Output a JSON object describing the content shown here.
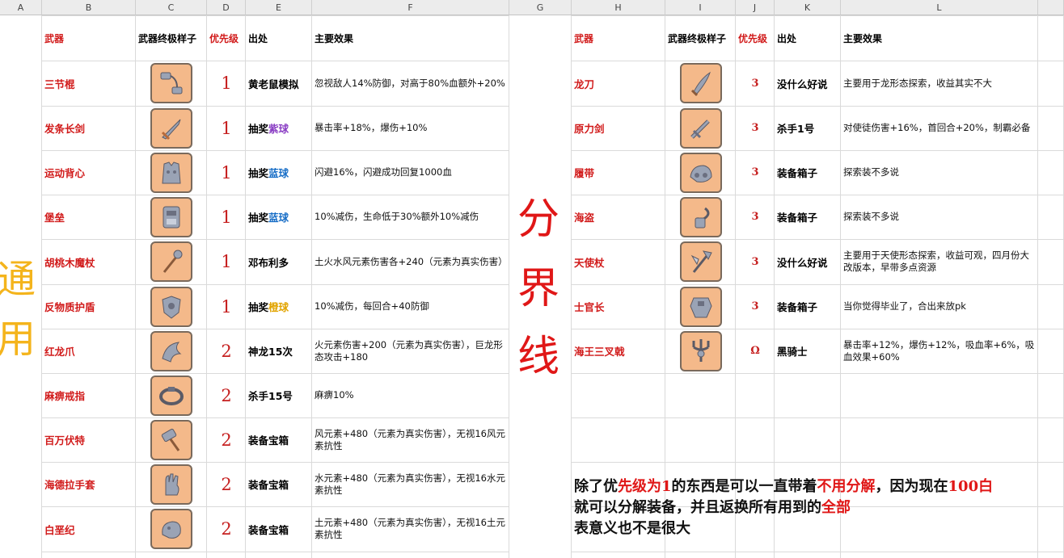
{
  "columns": [
    "A",
    "B",
    "C",
    "D",
    "E",
    "F",
    "G",
    "H",
    "I",
    "J",
    "K",
    "L"
  ],
  "left_headers": {
    "weapon": "武器",
    "look": "武器终极样子",
    "priority": "优先级",
    "source": "出处",
    "effect": "主要效果"
  },
  "right_headers": {
    "weapon": "武器",
    "look": "武器终极样子",
    "priority": "优先级",
    "source": "出处",
    "effect": "主要效果"
  },
  "left_rows": [
    {
      "name": "三节棍",
      "priority": "1",
      "source": "黄老鼠模拟",
      "source_suffix": "",
      "effect": "忽视敌人14%防御，对高于80%血额外+20%",
      "icon": "nunchaku-icon"
    },
    {
      "name": "发条长剑",
      "priority": "1",
      "source": "抽奖",
      "source_suffix": "紫球",
      "suffix_color": "purple",
      "effect": "暴击率+18%，爆伤+10%",
      "icon": "sword-icon"
    },
    {
      "name": "运动背心",
      "priority": "1",
      "source": "抽奖",
      "source_suffix": "蓝球",
      "suffix_color": "blue",
      "effect": "闪避16%，闪避成功回复1000血",
      "icon": "vest-icon"
    },
    {
      "name": "堡垒",
      "priority": "1",
      "source": "抽奖",
      "source_suffix": "蓝球",
      "suffix_color": "blue",
      "effect": "10%减伤，生命低于30%额外10%减伤",
      "icon": "fortress-icon"
    },
    {
      "name": "胡桃木魔杖",
      "priority": "1",
      "source": "邓布利多",
      "source_suffix": "",
      "effect": "土火水风元素伤害各+240（元素为真实伤害）",
      "icon": "wand-icon"
    },
    {
      "name": "反物质护盾",
      "priority": "1",
      "source": "抽奖",
      "source_suffix": "橙球",
      "suffix_color": "orange",
      "effect": "10%减伤，每回合+40防御",
      "icon": "shield-icon"
    },
    {
      "name": "红龙爪",
      "priority": "2",
      "source": "神龙15次",
      "source_suffix": "",
      "effect": "火元素伤害+200（元素为真实伤害），巨龙形态攻击+180",
      "icon": "claw-icon"
    },
    {
      "name": "麻痹戒指",
      "priority": "2",
      "source": "杀手15号",
      "source_suffix": "",
      "effect": "麻痹10%",
      "icon": "ring-icon"
    },
    {
      "name": "百万伏特",
      "priority": "2",
      "source": "装备宝箱",
      "source_suffix": "",
      "effect": "风元素+480（元素为真实伤害），无视16风元素抗性",
      "icon": "hammer-icon"
    },
    {
      "name": "海德拉手套",
      "priority": "2",
      "source": "装备宝箱",
      "source_suffix": "",
      "effect": "水元素+480（元素为真实伤害），无视16水元素抗性",
      "icon": "glove-icon"
    },
    {
      "name": "白垩纪",
      "priority": "2",
      "source": "装备宝箱",
      "source_suffix": "",
      "effect": "土元素+480（元素为真实伤害），无视16土元素抗性",
      "icon": "fossil-icon"
    }
  ],
  "right_rows": [
    {
      "name": "龙刀",
      "priority": "3",
      "source": "没什么好说",
      "effect": "主要用于龙形态探索，收益其实不大",
      "icon": "dagger-icon"
    },
    {
      "name": "原力剑",
      "priority": "3",
      "source": "杀手1号",
      "effect": "对使徒伤害+16%，首回合+20%，制霸必备",
      "icon": "force-sword-icon"
    },
    {
      "name": "履带",
      "priority": "3",
      "source": "装备箱子",
      "effect": "探索装不多说",
      "icon": "track-icon"
    },
    {
      "name": "海盗",
      "priority": "3",
      "source": "装备箱子",
      "effect": "探索装不多说",
      "icon": "hook-icon"
    },
    {
      "name": "天使杖",
      "priority": "3",
      "source": "没什么好说",
      "effect": "主要用于天使形态探索，收益可观，四月份大改版本，早带多点资源",
      "icon": "angel-staff-icon"
    },
    {
      "name": "士官长",
      "priority": "3",
      "source": "装备箱子",
      "effect": "当你觉得毕业了，合出来放pk",
      "icon": "armor-icon"
    },
    {
      "name": "海王三叉戟",
      "priority": "Ω",
      "source": "黑骑士",
      "effect": "暴击率+12%，爆伤+12%，吸血率+6%，吸血效果+60%",
      "icon": "trident-icon"
    }
  ],
  "divider_chars": [
    "分",
    "界",
    "线"
  ],
  "side_label_chars": [
    "通",
    "用"
  ],
  "note": {
    "p1": "除了优",
    "r1": "先级为1",
    "p2": "的东西是可以一直带着",
    "r2": "不用分解",
    "p3": "，因为现在",
    "r3": "100白",
    "line2a": "就可以分解装备，并且返换所有用到的",
    "r4": "全部",
    "line3": "表意义也不是很大"
  }
}
